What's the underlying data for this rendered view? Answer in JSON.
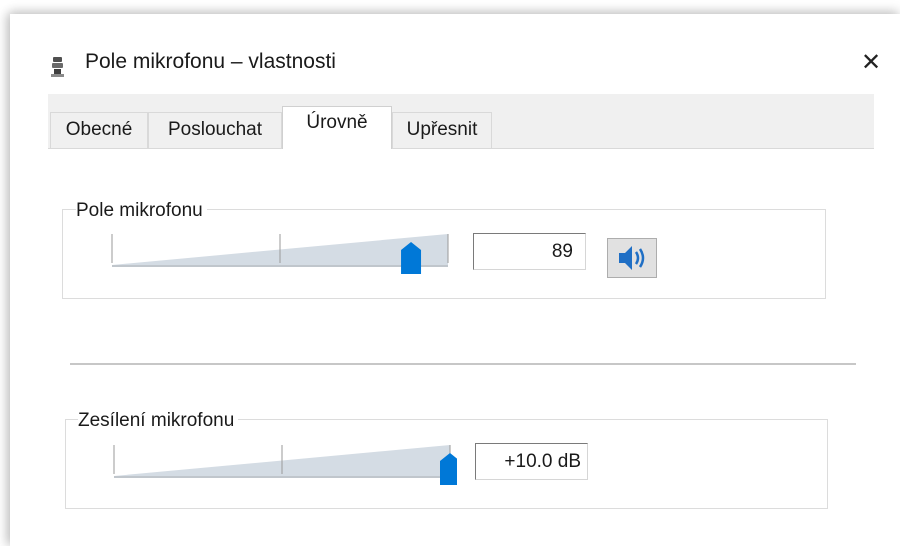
{
  "window": {
    "title": "Pole mikrofonu – vlastnosti",
    "close_symbol": "✕"
  },
  "tabs": [
    {
      "label": "Obecné",
      "active": false
    },
    {
      "label": "Poslouchat",
      "active": false
    },
    {
      "label": "Úrovně",
      "active": true
    },
    {
      "label": "Upřesnit",
      "active": false
    }
  ],
  "levels": {
    "microphone": {
      "label": "Pole mikrofonu",
      "value": "89",
      "level": 0.89,
      "mute_icon": "speaker-icon"
    },
    "boost": {
      "label": "Zesílení mikrofonu",
      "value": "+10.0 dB",
      "level": 1.0
    }
  },
  "colors": {
    "accent": "#0078d7",
    "track_fill": "#d4dce4"
  }
}
